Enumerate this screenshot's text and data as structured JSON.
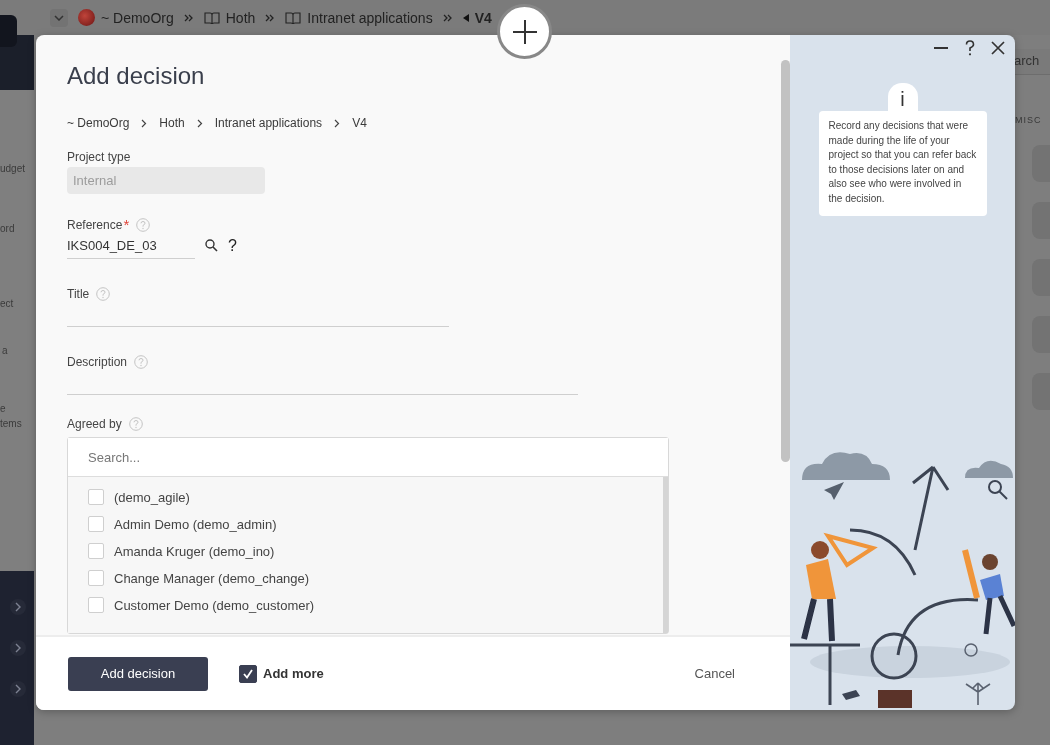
{
  "background": {
    "breadcrumb": [
      {
        "label": "~ DemoOrg",
        "kind": "org"
      },
      {
        "label": "Hoth",
        "kind": "book"
      },
      {
        "label": "Intranet applications",
        "kind": "book"
      },
      {
        "label": "V4",
        "kind": "current"
      }
    ],
    "sidebar_fragments": [
      "udget",
      "ord",
      "ect",
      "a",
      "e",
      "tems"
    ],
    "search_fragment": "arch",
    "section_label": "MISC"
  },
  "dialog": {
    "title": "Add decision",
    "breadcrumb": [
      "~ DemoOrg",
      "Hoth",
      "Intranet applications",
      "V4"
    ],
    "fields": [
      {
        "kind": "readonly",
        "label": "Project type",
        "value": "Internal",
        "help": false
      },
      {
        "kind": "reference",
        "label": "Reference",
        "required_mark": "*",
        "help": true,
        "value": "IKS004_DE_03",
        "extra": "?"
      },
      {
        "kind": "text",
        "label": "Title",
        "help": true
      },
      {
        "kind": "textarea",
        "label": "Description",
        "help": true
      }
    ],
    "agreed_by": {
      "label": "Agreed by",
      "help": true,
      "placeholder": "Search...",
      "options": [
        {
          "label": "(demo_agile)",
          "checked": false
        },
        {
          "label": "Admin Demo (demo_admin)",
          "checked": false
        },
        {
          "label": "Amanda Kruger (demo_ino)",
          "checked": false
        },
        {
          "label": "Change Manager (demo_change)",
          "checked": false
        },
        {
          "label": "Customer Demo (demo_customer)",
          "checked": false
        }
      ]
    },
    "footer": {
      "submit": "Add decision",
      "add_more": {
        "label": "Add more",
        "checked": true
      },
      "cancel": "Cancel"
    },
    "info": {
      "icon": "i",
      "text": "Record any decisions that were made during the life of your project so that you can refer back to those decisions later on and also see who were involved in the decision."
    }
  }
}
